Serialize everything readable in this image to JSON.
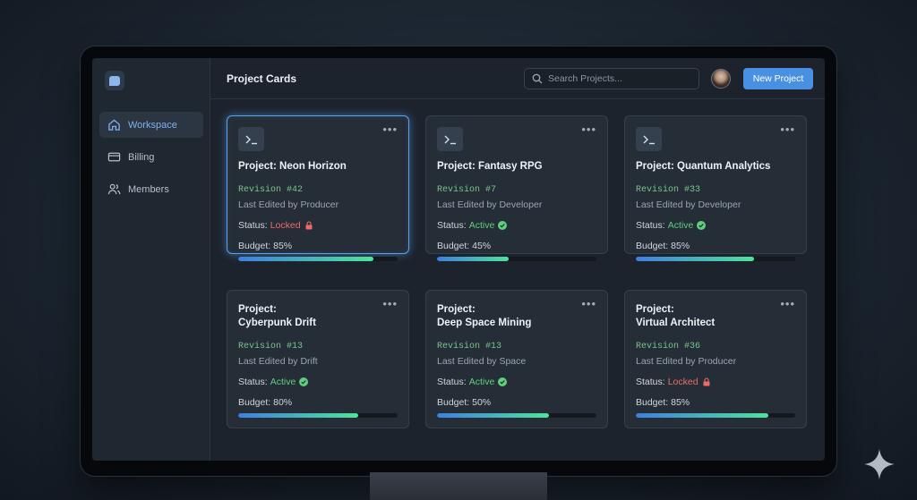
{
  "sidebar": {
    "items": [
      {
        "label": "Workspace",
        "icon": "home-icon"
      },
      {
        "label": "Billing",
        "icon": "credit-card-icon"
      },
      {
        "label": "Members",
        "icon": "users-icon"
      }
    ]
  },
  "header": {
    "title": "Project Cards",
    "search_placeholder": "Search Projects...",
    "new_project_label": "New Project"
  },
  "colors": {
    "accent": "#4a90e2",
    "active": "#5fcf7e",
    "locked": "#ef6b6b",
    "revision": "#79c48a"
  },
  "cards": [
    {
      "title": "Project: Neon Horizon",
      "revision": "Revision #42",
      "edited": "Last Edited by Producer",
      "status_label": "Status:",
      "status": "Locked",
      "status_type": "locked",
      "budget": "Budget: 85%",
      "budget_pct": 85
    },
    {
      "title": "Project: Fantasy RPG",
      "revision": "Revision #7",
      "edited": "Last Edited by Developer",
      "status_label": "Status:",
      "status": "Active",
      "status_type": "active",
      "budget": "Budget: 45%",
      "budget_pct": 45
    },
    {
      "title": "Project: Quantum Analytics",
      "revision": "Revision #33",
      "edited": "Last Edited by Developer",
      "status_label": "Status:",
      "status": "Active",
      "status_type": "active",
      "budget": "Budget: 85%",
      "budget_pct": 74
    },
    {
      "title_line1": "Project:",
      "title_line2": "Cyberpunk Drift",
      "revision": "Revision #13",
      "edited": "Last Edited by Drift",
      "status_label": "Status:",
      "status": "Active",
      "status_type": "active",
      "budget": "Budget: 80%",
      "budget_pct": 75
    },
    {
      "title_line1": "Project:",
      "title_line2": "Deep Space Mining",
      "revision": "Revision #13",
      "edited": "Last Edited by Space",
      "status_label": "Status:",
      "status": "Active",
      "status_type": "active",
      "budget": "Budget: 50%",
      "budget_pct": 70
    },
    {
      "title_line1": "Project:",
      "title_line2": "Virtual Architect",
      "revision": "Revision #36",
      "edited": "Last Edited by Producer",
      "status_label": "Status:",
      "status": "Locked",
      "status_type": "locked",
      "budget": "Budget: 85%",
      "budget_pct": 83
    }
  ]
}
